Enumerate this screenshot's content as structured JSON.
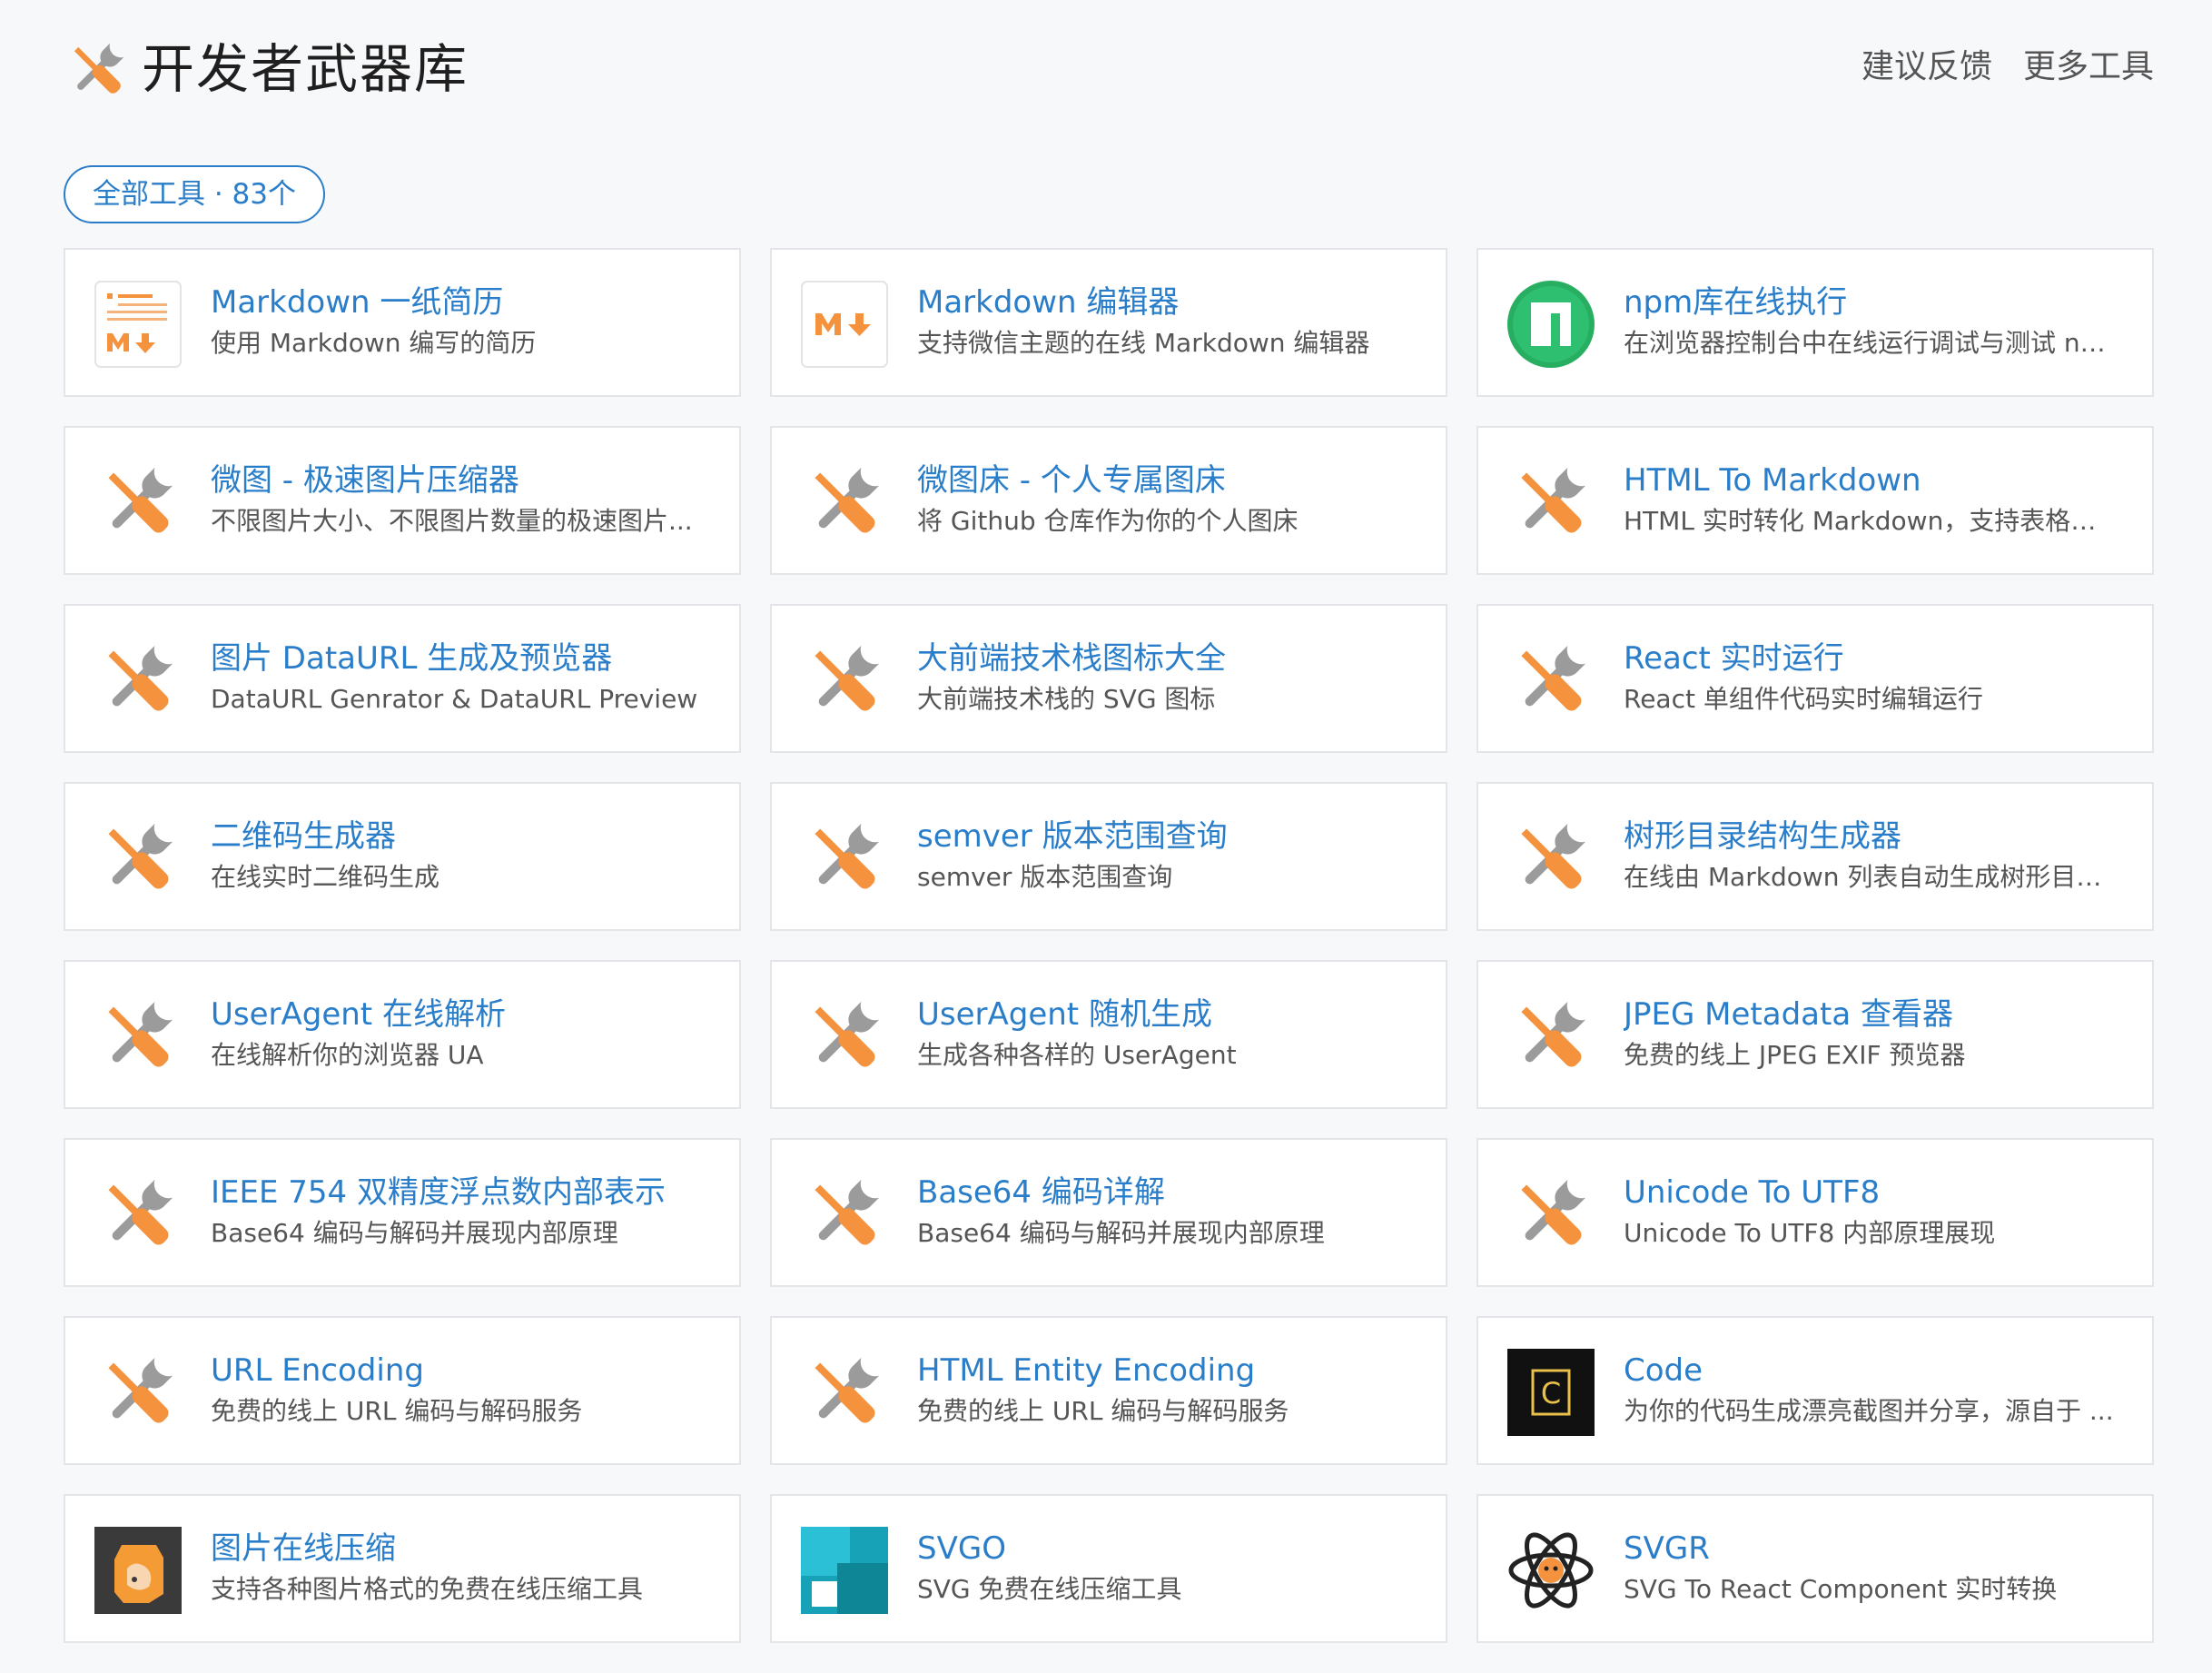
{
  "header": {
    "title": "开发者武器库",
    "nav": [
      "建议反馈",
      "更多工具"
    ]
  },
  "filter": {
    "label": "全部工具 · 83个"
  },
  "colors": {
    "accent": "#2a7ec9",
    "tool_orange": "#f5923e",
    "tool_gray": "#9b9b9b"
  },
  "tools": [
    {
      "name": "Markdown 一纸简历",
      "desc": "使用 Markdown 编写的简历",
      "icon": "resume-md-icon"
    },
    {
      "name": "Markdown 编辑器",
      "desc": "支持微信主题的在线 Markdown 编辑器",
      "icon": "markdown-icon"
    },
    {
      "name": "npm库在线执行",
      "desc": "在浏览器控制台中在线运行调试与测试 np...",
      "icon": "npm-icon"
    },
    {
      "name": "微图 - 极速图片压缩器",
      "desc": "不限图片大小、不限图片数量的极速图片...",
      "icon": "tools-icon"
    },
    {
      "name": "微图床 - 个人专属图床",
      "desc": "将 Github 仓库作为你的个人图床",
      "icon": "tools-icon"
    },
    {
      "name": "HTML To Markdown",
      "desc": "HTML 实时转化 Markdown，支持表格、...",
      "icon": "tools-icon"
    },
    {
      "name": "图片 DataURL 生成及预览器",
      "desc": "DataURL Genrator & DataURL Preview",
      "icon": "tools-icon"
    },
    {
      "name": "大前端技术栈图标大全",
      "desc": "大前端技术栈的 SVG 图标",
      "icon": "tools-icon"
    },
    {
      "name": "React 实时运行",
      "desc": "React 单组件代码实时编辑运行",
      "icon": "tools-icon"
    },
    {
      "name": "二维码生成器",
      "desc": "在线实时二维码生成",
      "icon": "tools-icon"
    },
    {
      "name": "semver 版本范围查询",
      "desc": "semver 版本范围查询",
      "icon": "tools-icon"
    },
    {
      "name": "树形目录结构生成器",
      "desc": "在线由 Markdown 列表自动生成树形目录...",
      "icon": "tools-icon"
    },
    {
      "name": "UserAgent 在线解析",
      "desc": "在线解析你的浏览器 UA",
      "icon": "tools-icon"
    },
    {
      "name": "UserAgent 随机生成",
      "desc": "生成各种各样的 UserAgent",
      "icon": "tools-icon"
    },
    {
      "name": "JPEG Metadata 查看器",
      "desc": "免费的线上 JPEG EXIF 预览器",
      "icon": "tools-icon"
    },
    {
      "name": "IEEE 754 双精度浮点数内部表示",
      "desc": "Base64 编码与解码并展现内部原理",
      "icon": "tools-icon"
    },
    {
      "name": "Base64 编码详解",
      "desc": "Base64 编码与解码并展现内部原理",
      "icon": "tools-icon"
    },
    {
      "name": "Unicode To UTF8",
      "desc": "Unicode To UTF8 内部原理展现",
      "icon": "tools-icon"
    },
    {
      "name": "URL Encoding",
      "desc": "免费的线上 URL 编码与解码服务",
      "icon": "tools-icon"
    },
    {
      "name": "HTML Entity Encoding",
      "desc": "免费的线上 URL 编码与解码服务",
      "icon": "tools-icon"
    },
    {
      "name": "Code",
      "desc": "为你的代码生成漂亮截图并分享，源自于 ...",
      "icon": "code-icon"
    },
    {
      "name": "图片在线压缩",
      "desc": "支持各种图片格式的免费在线压缩工具",
      "icon": "image-compress-icon"
    },
    {
      "name": "SVGO",
      "desc": "SVG 免费在线压缩工具",
      "icon": "svgo-icon"
    },
    {
      "name": "SVGR",
      "desc": "SVG To React Component 实时转换",
      "icon": "svgr-icon"
    }
  ]
}
